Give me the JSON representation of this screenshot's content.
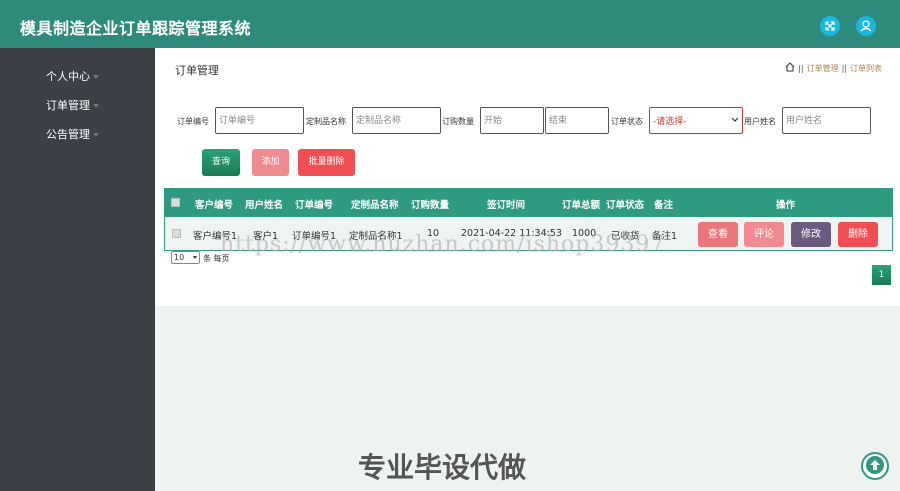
{
  "app": {
    "title": "模具制造企业订单跟踪管理系统",
    "icons": [
      "fullscreen-icon",
      "user-icon"
    ],
    "accent": "#2e8a7a"
  },
  "sidebar": {
    "items": [
      {
        "label": "个人中心"
      },
      {
        "label": "订单管理"
      },
      {
        "label": "公告管理"
      }
    ]
  },
  "page": {
    "title": "订单管理",
    "breadcrumb": [
      "订单管理",
      "订单列表"
    ]
  },
  "filters": {
    "order_no": {
      "label": "订单编号",
      "placeholder": "订单编号"
    },
    "product": {
      "label": "定制品名称",
      "placeholder": "定制品名称"
    },
    "qty": {
      "label": "订购数量",
      "start_placeholder": "开始",
      "end_placeholder": "结束"
    },
    "status": {
      "label": "订单状态",
      "selected": "-请选择-"
    },
    "user": {
      "label": "用户姓名",
      "placeholder": "用户姓名"
    }
  },
  "buttons": {
    "query": "查询",
    "add": "添加",
    "batch_delete": "批量删除"
  },
  "table": {
    "columns": [
      "客户编号",
      "用户姓名",
      "订单编号",
      "定制品名称",
      "订购数量",
      "签订时间",
      "订单总额",
      "订单状态",
      "备注",
      "操作"
    ],
    "rows": [
      {
        "customer_no": "客户编号1",
        "user_name": "客户1",
        "order_no": "订单编号1",
        "product": "定制品名称1",
        "qty": "10",
        "signed_at": "2021-04-22 11:34:53",
        "total": "1000",
        "status": "已收货",
        "remark": "备注1",
        "actions": [
          "查看",
          "评论",
          "修改",
          "删除"
        ]
      }
    ]
  },
  "pagination": {
    "page_size": "10",
    "per_page_label": "条 每页",
    "current_page": "1"
  },
  "watermark": {
    "url": "https://www.huzhan.com/ishop39397",
    "text": "专业毕设代做"
  }
}
